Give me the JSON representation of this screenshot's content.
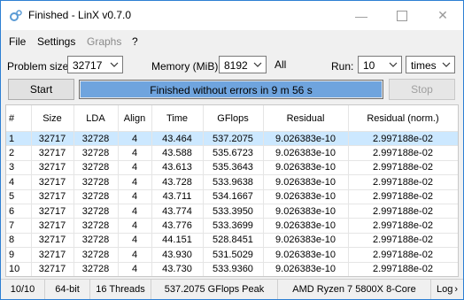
{
  "window": {
    "title": "Finished - LinX v0.7.0"
  },
  "menu": [
    "File",
    "Settings",
    "Graphs",
    "?"
  ],
  "controls": {
    "problem_size_label": "Problem size:",
    "problem_size_value": "32717",
    "memory_label": "Memory (MiB):",
    "memory_value": "8192",
    "all_label": "All",
    "run_label": "Run:",
    "run_value": "10",
    "run_unit": "times"
  },
  "buttons": {
    "start": "Start",
    "stop": "Stop"
  },
  "progress": {
    "text": "Finished without errors in 9 m 56 s",
    "fraction": 1.0
  },
  "table": {
    "headers": [
      "#",
      "Size",
      "LDA",
      "Align",
      "Time",
      "GFlops",
      "Residual",
      "Residual (norm.)"
    ],
    "rows": [
      [
        "1",
        "32717",
        "32728",
        "4",
        "43.464",
        "537.2075",
        "9.026383e-10",
        "2.997188e-02"
      ],
      [
        "2",
        "32717",
        "32728",
        "4",
        "43.588",
        "535.6723",
        "9.026383e-10",
        "2.997188e-02"
      ],
      [
        "3",
        "32717",
        "32728",
        "4",
        "43.613",
        "535.3643",
        "9.026383e-10",
        "2.997188e-02"
      ],
      [
        "4",
        "32717",
        "32728",
        "4",
        "43.728",
        "533.9638",
        "9.026383e-10",
        "2.997188e-02"
      ],
      [
        "5",
        "32717",
        "32728",
        "4",
        "43.711",
        "534.1667",
        "9.026383e-10",
        "2.997188e-02"
      ],
      [
        "6",
        "32717",
        "32728",
        "4",
        "43.774",
        "533.3950",
        "9.026383e-10",
        "2.997188e-02"
      ],
      [
        "7",
        "32717",
        "32728",
        "4",
        "43.776",
        "533.3699",
        "9.026383e-10",
        "2.997188e-02"
      ],
      [
        "8",
        "32717",
        "32728",
        "4",
        "44.151",
        "528.8451",
        "9.026383e-10",
        "2.997188e-02"
      ],
      [
        "9",
        "32717",
        "32728",
        "4",
        "43.930",
        "531.5029",
        "9.026383e-10",
        "2.997188e-02"
      ],
      [
        "10",
        "32717",
        "32728",
        "4",
        "43.730",
        "533.9360",
        "9.026383e-10",
        "2.997188e-02"
      ]
    ],
    "selected_row": 0
  },
  "status": {
    "runs": "10/10",
    "arch": "64-bit",
    "threads": "16 Threads",
    "peak": "537.2075 GFlops Peak",
    "cpu": "AMD Ryzen 7 5800X 8-Core",
    "log": "Log"
  },
  "colors": {
    "accent_border": "#2d7fd3",
    "progress_fill": "#6fa4de",
    "selected_row": "#cce8ff"
  }
}
